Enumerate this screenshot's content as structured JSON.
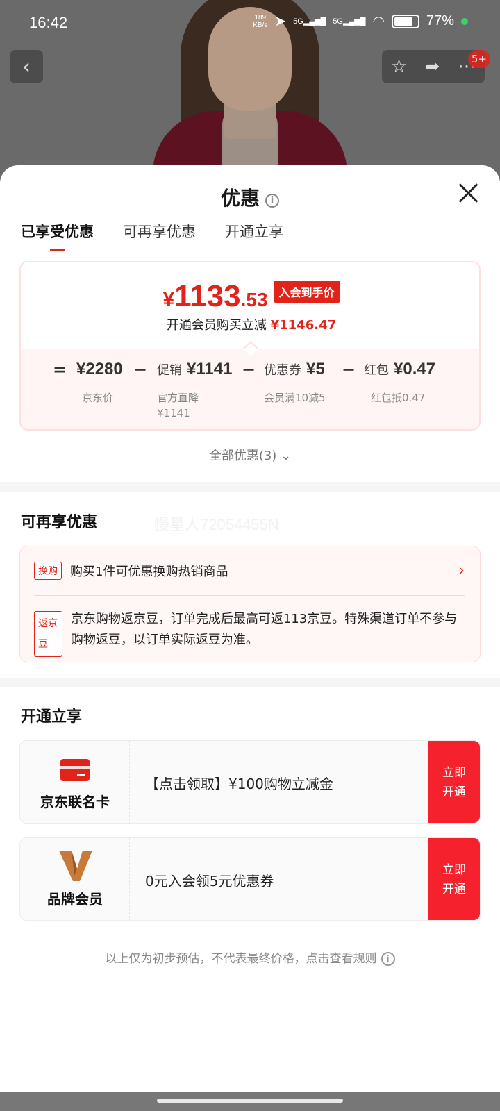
{
  "status_bar": {
    "time": "16:42",
    "net_speed_top": "189",
    "net_speed_bottom": "KB/s",
    "sig1": "5G",
    "sig2": "5G",
    "battery": "77%"
  },
  "top_nav": {
    "cart_badge": "5+"
  },
  "sheet": {
    "title": "优惠",
    "tabs": [
      "已享受优惠",
      "可再享优惠",
      "开通立享"
    ],
    "price": {
      "yen": "¥",
      "integer": "1133",
      "decimal": ".53",
      "tag": "入会到手价",
      "sub_text": "开通会员购买立减",
      "sub_amount": "¥1146.47"
    },
    "formula": {
      "eq": "=",
      "items": [
        {
          "label": "",
          "amount": "¥2280",
          "sub1": "京东价",
          "sub2": ""
        },
        {
          "label": "促销",
          "amount": "¥1141",
          "sub1": "官方直降",
          "sub2": "¥1141"
        },
        {
          "label": "优惠券",
          "amount": "¥5",
          "sub1": "会员满10减5",
          "sub2": ""
        },
        {
          "label": "红包",
          "amount": "¥0.47",
          "sub1": "红包抵0.47",
          "sub2": ""
        }
      ],
      "minus": "−"
    },
    "all_deals": "全部优惠(3)",
    "more_section_title": "可再享优惠",
    "watermark": "慢星人72054455N",
    "more": {
      "row1_chip": "换购",
      "row1_text": "购买1件可优惠换购热销商品",
      "row2_chip": "返京豆",
      "row2_text": "京东购物返京豆，订单完成后最高可返113京豆。特殊渠道订单不参与购物返豆，以订单实际返豆为准。"
    },
    "open_section_title": "开通立享",
    "offers": [
      {
        "name": "京东联名卡",
        "text": "【点击领取】¥100购物立减金",
        "button": "立即开通"
      },
      {
        "name": "品牌会员",
        "text": "0元入会领5元优惠券",
        "button": "立即开通"
      }
    ],
    "disclaimer": "以上仅为初步预估，不代表最终价格，点击查看规则"
  }
}
